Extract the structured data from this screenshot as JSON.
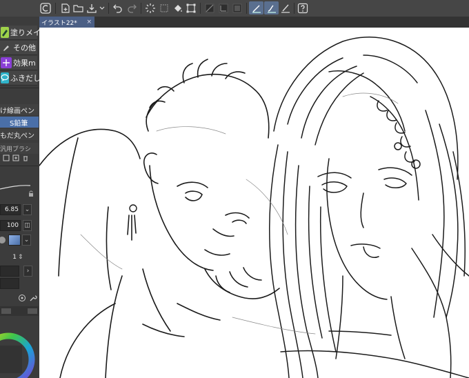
{
  "toolbar": {
    "icons": [
      "app-icon",
      "new-file-icon",
      "open-folder-icon",
      "save-icon",
      "undo-icon",
      "redo-icon",
      "loading-icon",
      "clear-icon",
      "fill-icon",
      "transform-icon",
      "snap-off-icon",
      "snap-range-icon",
      "snap-grid-icon",
      "ruler-pen-icon",
      "stabilize-icon",
      "brush-icon",
      "help-icon"
    ]
  },
  "canvas_tab": {
    "title": "イラスト22*",
    "close": "×"
  },
  "subtools": [
    {
      "label": "塗りメイ",
      "color": "#9fd24a"
    },
    {
      "label": "その他",
      "color": "#5a5a5a"
    },
    {
      "label": "効果m",
      "color": "#8a3fd6"
    },
    {
      "label": "ふきだし",
      "color": "#2fb3c9"
    }
  ],
  "brush_list": [
    {
      "label": "け線画ペン",
      "selected": false
    },
    {
      "label": "S鉛筆",
      "selected": true
    },
    {
      "label": "もだ丸ペン",
      "selected": false
    },
    {
      "label": "汎用ブラシ",
      "selected": false
    }
  ],
  "properties": {
    "brush_size": "6.85",
    "opacity": "100",
    "stabilization": "1"
  },
  "colors": {
    "accent": "#4a6fa8",
    "panel": "#3c3c3c",
    "canvas": "#ffffff"
  }
}
